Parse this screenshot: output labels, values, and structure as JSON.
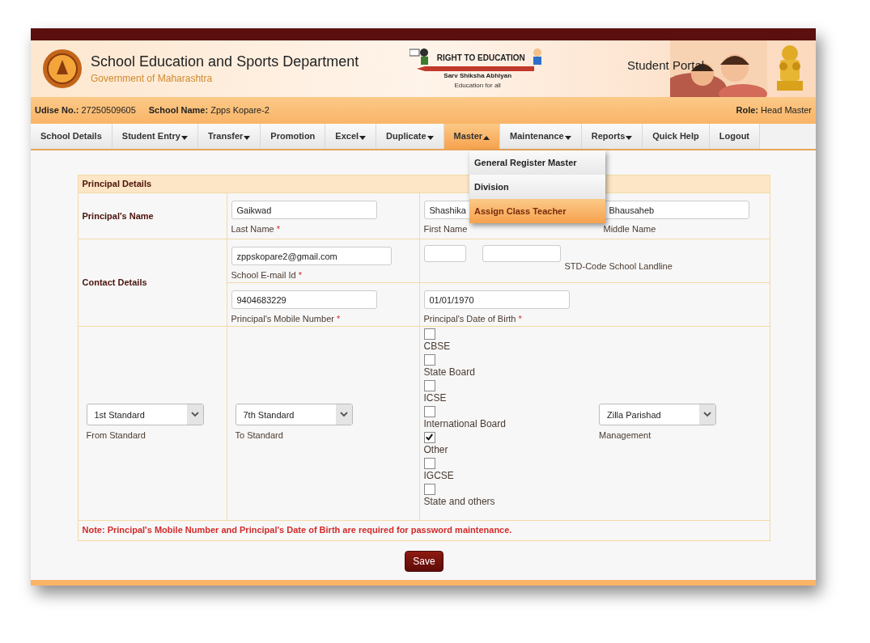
{
  "header": {
    "title": "School Education and Sports Department",
    "subtitle": "Government of Maharashtra",
    "rte": {
      "heading": "RIGHT TO EDUCATION",
      "name": "Sarv Shiksha Abhiyan",
      "tagline": "Education for all"
    },
    "portal": "Student Portal"
  },
  "info_bar": {
    "udise_label": "Udise No.:",
    "udise": "27250509605",
    "school_label": "School Name:",
    "school": "Zpps Kopare-2",
    "role_label": "Role:",
    "role": "Head Master"
  },
  "nav": [
    {
      "label": "School Details",
      "has_menu": false,
      "expanded": false
    },
    {
      "label": "Student Entry",
      "has_menu": true,
      "expanded": false
    },
    {
      "label": "Transfer",
      "has_menu": true,
      "expanded": false
    },
    {
      "label": "Promotion",
      "has_menu": false,
      "expanded": false
    },
    {
      "label": "Excel",
      "has_menu": true,
      "expanded": false
    },
    {
      "label": "Duplicate",
      "has_menu": true,
      "expanded": false
    },
    {
      "label": "Master",
      "has_menu": true,
      "expanded": true
    },
    {
      "label": "Maintenance",
      "has_menu": true,
      "expanded": false
    },
    {
      "label": "Reports",
      "has_menu": true,
      "expanded": false
    },
    {
      "label": "Quick Help",
      "has_menu": false,
      "expanded": false
    },
    {
      "label": "Logout",
      "has_menu": false,
      "expanded": false
    }
  ],
  "menu": [
    {
      "label": "General Register Master",
      "selected": false
    },
    {
      "label": "Division",
      "selected": false
    },
    {
      "label": "Assign Class Teacher",
      "selected": true
    }
  ],
  "form": {
    "title": "Principal Details",
    "required_mark": "*",
    "name_label": "Principal's Name",
    "last_name": {
      "value": "Gaikwad",
      "label": "Last Name",
      "required": true
    },
    "first_name": {
      "value": "Shashika",
      "label": "First Name",
      "required": false
    },
    "middle_name": {
      "value": "Bhausaheb",
      "label": "Middle Name",
      "required": false
    },
    "contact_label": "Contact Details",
    "email": {
      "value": "zppskopare2@gmail.com",
      "label": "School E-mail Id",
      "required": true
    },
    "landline": {
      "label": "STD-Code School Landline",
      "required": false
    },
    "mobile": {
      "value": "9404683229",
      "label": "Principal's Mobile Number",
      "required": true
    },
    "dob": {
      "value": "01/01/1970",
      "label": "Principal's Date of Birth",
      "required": true
    },
    "from_standard": {
      "value": "1st Standard",
      "label": "From Standard"
    },
    "to_standard": {
      "value": "7th Standard",
      "label": "To Standard"
    },
    "boards": [
      {
        "label": "CBSE",
        "checked": false
      },
      {
        "label": "State Board",
        "checked": false
      },
      {
        "label": "ICSE",
        "checked": false
      },
      {
        "label": "International Board",
        "checked": false
      },
      {
        "label": "Other",
        "checked": true
      },
      {
        "label": "IGCSE",
        "checked": false
      },
      {
        "label": "State and others",
        "checked": false
      }
    ],
    "management": {
      "value": "Zilla Parishad",
      "label": "Management"
    },
    "note": "Note: Principal's Mobile Number and Principal's Date of Birth are required for password maintenance."
  },
  "save": "Save"
}
